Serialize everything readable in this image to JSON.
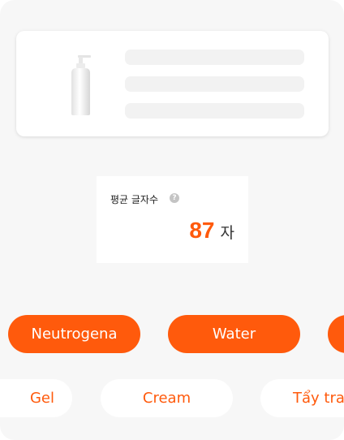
{
  "stats": {
    "avg_chars_label": "평균 글자수",
    "help_glyph": "?",
    "avg_chars_value": "87",
    "avg_chars_unit": "자"
  },
  "keywords_row1": [
    "Neutrogena",
    "Water"
  ],
  "keywords_row2": [
    "Gel",
    "Cream",
    "Tẩy tran"
  ],
  "colors": {
    "accent": "#ff5a0c",
    "background": "#f7f7f7",
    "card": "#ffffff",
    "skeleton": "#f2f2f2"
  }
}
